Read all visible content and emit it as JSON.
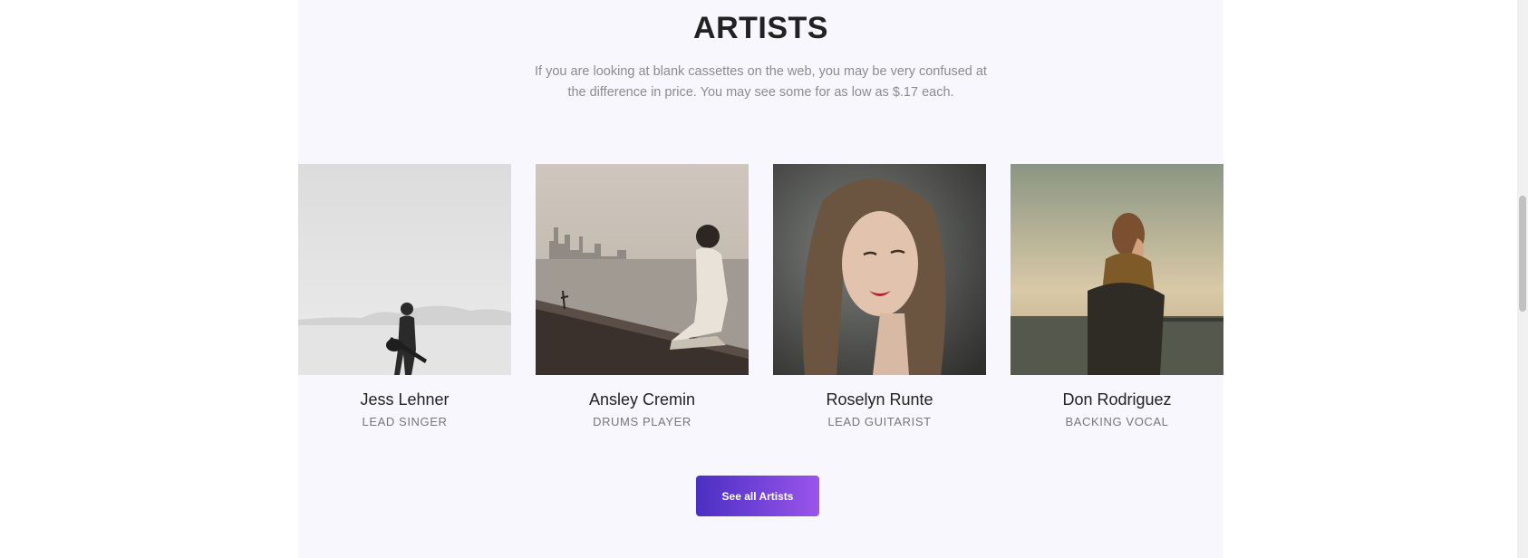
{
  "section": {
    "title": "ARTISTS",
    "subtitle": "If you are looking at blank cassettes on the web, you may be very confused at the difference in price. You may see some for as low as $.17 each."
  },
  "artists": [
    {
      "name": "Jess Lehner",
      "role": "LEAD SINGER",
      "photo_icon": "guitarist-desert-photo"
    },
    {
      "name": "Ansley Cremin",
      "role": "DRUMS PLAYER",
      "photo_icon": "man-by-lake-photo"
    },
    {
      "name": "Roselyn Runte",
      "role": "LEAD GUITARIST",
      "photo_icon": "woman-portrait-photo"
    },
    {
      "name": "Don Rodriguez",
      "role": "BACKING VOCAL",
      "photo_icon": "man-scarf-photo"
    }
  ],
  "cta": {
    "label": "See all Artists"
  },
  "colors": {
    "section_background": "#f8f7fd",
    "button_gradient_start": "#4a2fc4",
    "button_gradient_end": "#9b55ea",
    "title": "#222222",
    "subtitle": "#8c8c8c"
  }
}
